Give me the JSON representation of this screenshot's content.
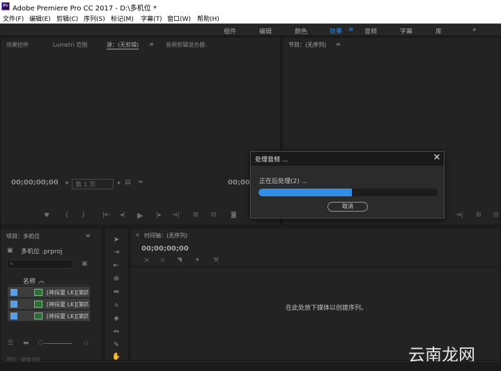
{
  "app": {
    "logo": "Pr",
    "title": "Adobe Premiere Pro CC 2017 - D:\\多机位 *"
  },
  "menu": [
    "文件(F)",
    "编辑(E)",
    "剪辑(C)",
    "序列(S)",
    "标记(M)",
    "字幕(T)",
    "窗口(W)",
    "帮助(H)"
  ],
  "workspaces": {
    "tabs": [
      "组件",
      "编辑",
      "颜色",
      "效果",
      "音频",
      "字幕",
      "库"
    ],
    "active": "效果",
    "menu_glyph": "≡",
    "more": "»"
  },
  "source_panel": {
    "tabs": [
      "效果控件",
      "Lumetri 范围",
      "源：(无剪辑)",
      "音频剪辑混合器:"
    ],
    "menu_glyph": "≡",
    "timecode": "00;00;00;00",
    "timecode_right": "00;00",
    "page_selector": "第 1 页"
  },
  "program_panel": {
    "tab": "节目：(无序列)",
    "menu_glyph": "≡"
  },
  "project_panel": {
    "tab": "项目：多机位",
    "menu_glyph": "≡",
    "project_file": "多机位 .prproj",
    "column_name": "名称",
    "items": [
      "[神探夏 LK][第四",
      "[神探夏 LK][第四",
      "[神探夏 LK][第四"
    ],
    "bottom_label": "项目：媒体浏览"
  },
  "timeline_panel": {
    "tab": "时间轴：(无序列)",
    "timecode": "00;00;00;00",
    "empty_message": "在此处放下媒体以创建序列。"
  },
  "dialog": {
    "title": "处理音频 ...",
    "close": "✕",
    "status": "正在后处理(2) ...",
    "progress": 0.52,
    "cancel": "取消"
  },
  "watermark": "云南龙网",
  "colors": {
    "accent": "#2d8ceb",
    "progress": "#2f8fe8"
  }
}
